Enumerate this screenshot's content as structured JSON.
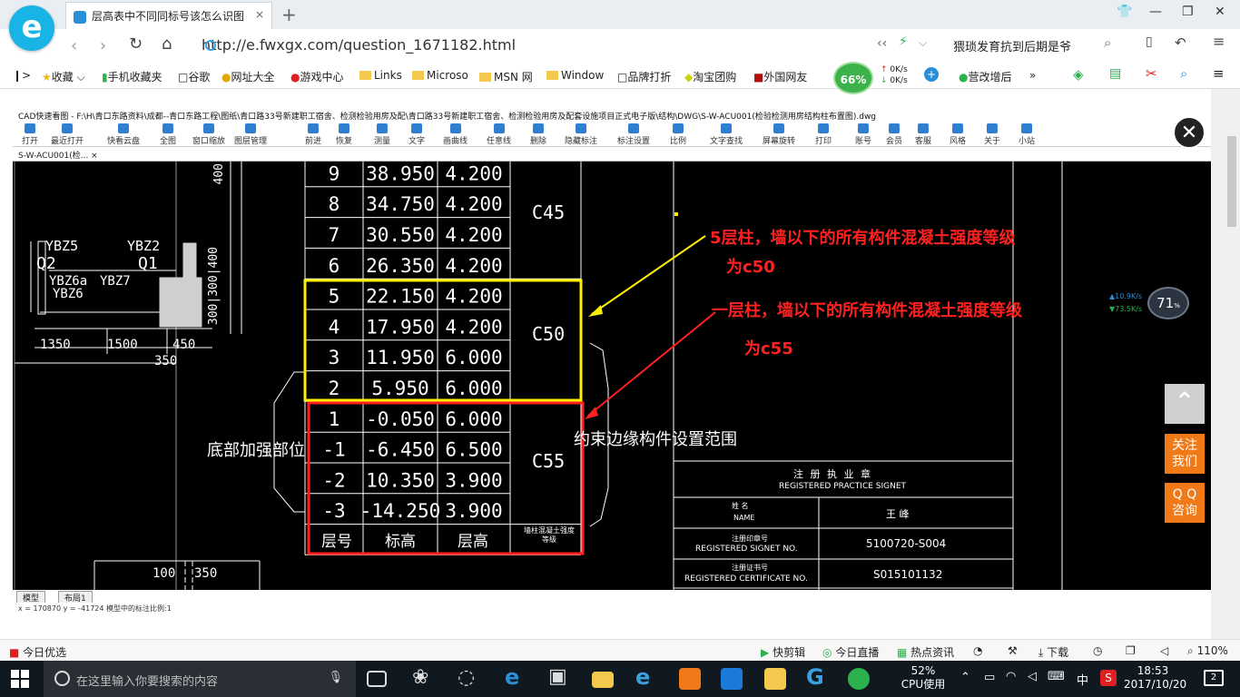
{
  "browser": {
    "logo_letter": "e",
    "tab_title": "层高表中不同同标号该怎么识图",
    "tab_close": "×",
    "new_tab": "+",
    "url": "http://e.fwxgx.com/question_1671182.html",
    "hot_search": "猥琐发育抗到后期是爷",
    "zoom": "110%",
    "speed_percent": "66%",
    "net_up": "0K/s",
    "net_down": "0K/s"
  },
  "bookmarks": [
    {
      "label": "收藏"
    },
    {
      "label": "手机收藏夹"
    },
    {
      "label": "谷歌"
    },
    {
      "label": "网址大全"
    },
    {
      "label": "游戏中心"
    },
    {
      "label": "Links"
    },
    {
      "label": "Microso"
    },
    {
      "label": "MSN 网"
    },
    {
      "label": "Window"
    },
    {
      "label": "品牌打折"
    },
    {
      "label": "淘宝团购"
    },
    {
      "label": "外国网友"
    },
    {
      "label": "营改增后"
    }
  ],
  "cad": {
    "title": "CAD快速看图 - F:\\H\\青口东路资料\\成都--青口东路工程\\图纸\\青口路33号新建职工宿舍、检测检验用房及配\\青口路33号新建职工宿舍、检测检验用房及配套设施项目正式电子版\\结构\\DWG\\S-W-ACU001(检验检测用房结构柱布置图).dwg",
    "tab": "S-W-ACU001(检... ×",
    "toolbar": [
      "打开",
      "最近打开",
      "快看云盘",
      "全图",
      "窗口缩放",
      "图层管理",
      "前进",
      "恢复",
      "测量",
      "文字",
      "画曲线",
      "任意线",
      "删除",
      "隐藏标注",
      "标注设置",
      "比例",
      "文字查找",
      "屏幕旋转",
      "打印",
      "账号",
      "会员",
      "客服",
      "风格",
      "关于",
      "小站"
    ],
    "layouts": [
      "模型",
      "布局1"
    ],
    "status": "x = 170870  y = -41724                                    模型中的标注比例:1",
    "floor_table": [
      {
        "floor": "9",
        "elev": "38.950",
        "height": "4.200"
      },
      {
        "floor": "8",
        "elev": "34.750",
        "height": "4.200"
      },
      {
        "floor": "7",
        "elev": "30.550",
        "height": "4.200"
      },
      {
        "floor": "6",
        "elev": "26.350",
        "height": "4.200"
      },
      {
        "floor": "5",
        "elev": "22.150",
        "height": "4.200"
      },
      {
        "floor": "4",
        "elev": "17.950",
        "height": "4.200"
      },
      {
        "floor": "3",
        "elev": "11.950",
        "height": "6.000"
      },
      {
        "floor": "2",
        "elev": "5.950",
        "height": "6.000"
      },
      {
        "floor": "1",
        "elev": "-0.050",
        "height": "6.000"
      },
      {
        "floor": "-1",
        "elev": "-6.450",
        "height": "6.500"
      },
      {
        "floor": "-2",
        "elev": "10.350",
        "height": "3.900"
      },
      {
        "floor": "-3",
        "elev": "-14.250",
        "height": "3.900"
      }
    ],
    "grade_c45": "C45",
    "grade_c50": "C50",
    "grade_c55": "C55",
    "header_floor": "层号",
    "header_elev": "标高",
    "header_height": "层高",
    "header_grade": "墙柱混凝土强度等级",
    "left_note": "底部加强部位",
    "right_note": "约束边缘构件设置范围",
    "ybz5": "YBZ5",
    "ybz2": "YBZ2",
    "q2": "Q2",
    "q1": "Q1",
    "ybz6a": "YBZ6a",
    "ybz7": "YBZ7",
    "ybz6": "YBZ6",
    "dim1350": "1350",
    "dim1500": "1500",
    "dim450": "450",
    "dim350": "350",
    "dim100": "100",
    "dim350b": "350",
    "vdim": "300|300|400",
    "vdim2": "400",
    "signet_title": "注 册 执 业 章",
    "signet_en": "REGISTERED PRACTICE SIGNET",
    "name_cn": "姓  名",
    "name_en": "NAME",
    "name_val": "王  峰",
    "signet_no_cn": "注册印章号",
    "signet_no_en": "REGISTERED SIGNET NO.",
    "signet_no_val": "5100720-S004",
    "cert_cn": "注册证书号",
    "cert_en": "REGISTERED CERTIFICATE NO.",
    "cert_val": "S015101132"
  },
  "annotations": {
    "a1_line1": "5层柱，墙以下的所有构件混凝土强度等级",
    "a1_line2": "为c50",
    "a2_line1": "一层柱，墙以下的所有构件混凝土强度等级",
    "a2_line2": "为c55",
    "color_yellow": "#ffee00",
    "color_red": "#ff2020"
  },
  "side": {
    "follow": "关注\n我们",
    "qq": "Q Q\n咨询",
    "monitor_pct": "71",
    "monitor_up": "10.9K/s",
    "monitor_down": "73.5K/s"
  },
  "status_bar": {
    "today": "今日优选",
    "kuaijianji": "快剪辑",
    "live": "今日直播",
    "news": "热点资讯",
    "download": "下载",
    "zoom": "110%"
  },
  "taskbar": {
    "search_placeholder": "在这里输入你要搜索的内容",
    "cpu_pct": "52%",
    "cpu_label": "CPU使用",
    "ime": "中",
    "time": "18:53",
    "date": "2017/10/20",
    "notif_count": "2"
  }
}
